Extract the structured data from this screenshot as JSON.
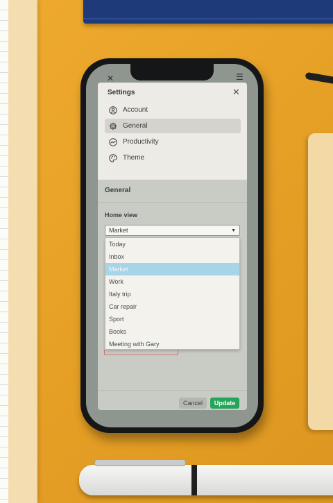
{
  "modal": {
    "title": "Settings",
    "close_icon": "close-icon"
  },
  "nav": {
    "items": [
      {
        "label": "Account",
        "icon": "account-icon"
      },
      {
        "label": "General",
        "icon": "gear-icon",
        "active": true
      },
      {
        "label": "Productivity",
        "icon": "productivity-icon"
      },
      {
        "label": "Theme",
        "icon": "palette-icon"
      }
    ]
  },
  "general": {
    "section_title": "General",
    "home_view_label": "Home view",
    "home_view_value": "Market",
    "options": [
      "Today",
      "Inbox",
      "Market",
      "Work",
      "Italy trip",
      "Car repair",
      "Sport",
      "Books",
      "Meeting with Gary"
    ],
    "selected_option": "Market"
  },
  "footer": {
    "cancel_label": "Cancel",
    "update_label": "Update"
  },
  "colors": {
    "accent_green": "#25a55a",
    "selected_option_bg": "#a7d5e8",
    "desk_orange": "#e8a128"
  }
}
